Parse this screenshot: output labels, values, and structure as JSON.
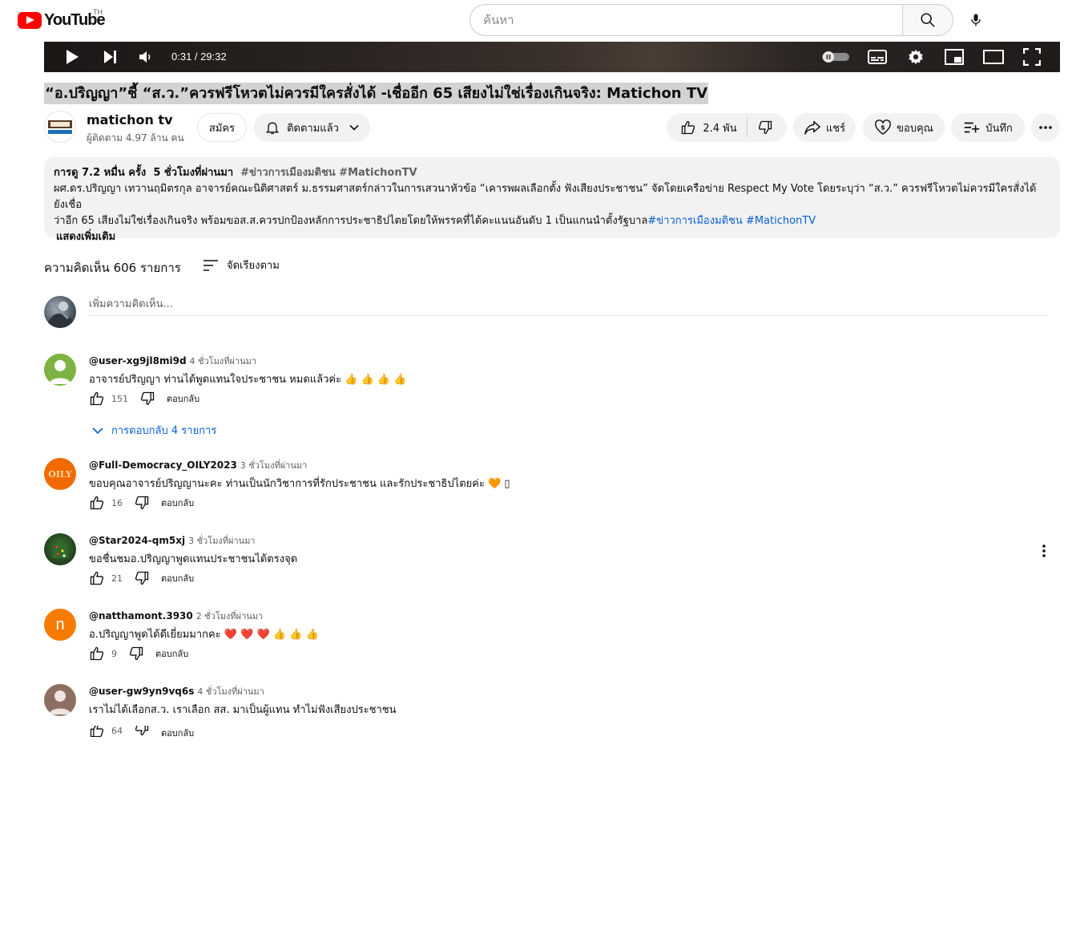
{
  "header": {
    "logo_text": "YouTube",
    "country_code": "TH",
    "search_placeholder": "ค้นหา"
  },
  "player": {
    "time": "0:31 / 29:32"
  },
  "video": {
    "title": "“อ.ปริญญา”ชี้ “ส.ว.”ควรฟรีโหวตไม่ควรมีใครสั่งได้ -เชื่ออีก 65 เสียงไม่ใช่เรื่องเกินจริง: Matichon TV"
  },
  "channel": {
    "name": "matichon tv",
    "subscribers": "ผู้ติดตาม 4.97 ล้าน คน",
    "join_label": "สมัคร",
    "subscribed_label": "ติดตามแล้ว"
  },
  "actions": {
    "likes": "2.4 พัน",
    "share": "แชร์",
    "thanks": "ขอบคุณ",
    "save": "บันทึก"
  },
  "description": {
    "views": "การดู 7.2 หมื่น ครั้ง",
    "posted": "5 ชั่วโมงที่ผ่านมา",
    "tags_top": "#ข่าวการเมืองมติชน #MatichonTV",
    "line1": "ผศ.ดร.ปริญญา เทวานฤมิตรกุล อาจารย์คณะนิติศาสตร์ ม.ธรรมศาสตร์กล่าวในการเสวนาหัวข้อ “เคารพผลเลือกตั้ง ฟังเสียงประชาชน” จัดโดยเครือข่าย Respect My Vote โดยระบุว่า “ส.ว.” ควรฟรีโหวตไม่ควรมีใครสั่งได้ ยังเชื่อ",
    "line2": "ว่าอีก 65 เสียงไม่ใช่เรื่องเกินจริง พร้อมขอส.ส.ควรปกป้องหลักการประชาธิปไตยโดยให้พรรคที่ได้คะแนนอันดับ 1 เป็นแกนนำตั้งรัฐบาล",
    "link1": "#ข่าวการเมืองมติชน",
    "link2": "#MatichonTV",
    "show_more": "แสดงเพิ่มเติม"
  },
  "comments_section": {
    "count_label": "ความคิดเห็น 606 รายการ",
    "sort_label": "จัดเรียงตาม",
    "add_placeholder": "เพิ่มความคิดเห็น..."
  },
  "comments": [
    {
      "author": "@user-xg9jl8mi9d",
      "ago": "4 ชั่วโมงที่ผ่านมา",
      "text": "อาจารย์ปริญญา ท่านได้พูดแทนใจประชาชน หมดแล้วค่ะ 👍 👍 👍 👍",
      "likes": "151",
      "reply": "ตอบกลับ",
      "replies": "การตอบกลับ 4 รายการ"
    },
    {
      "author": "@Full-Democracy_OILY2023",
      "ago": "3 ชั่วโมงที่ผ่านมา",
      "text": "ขอบคุณอาจารย์ปริญญานะคะ ท่านเป็นนักวิชาการที่รักประชาชน และรักประชาธิปไตยค่ะ 🧡 ▯",
      "likes": "16",
      "reply": "ตอบกลับ",
      "avatar_text": "OILY"
    },
    {
      "author": "@Star2024-qm5xj",
      "ago": "3 ชั่วโมงที่ผ่านมา",
      "text": "ขอชื่นชมอ.ปริญญาพูดแทนประชาชนได้ตรงจุด",
      "likes": "21",
      "reply": "ตอบกลับ"
    },
    {
      "author": "@natthamont.3930",
      "ago": "2 ชั่วโมงที่ผ่านมา",
      "text": "อ.ปริญญาพูดได้ดีเยี่ยมมากคะ ❤️ ❤️ ❤️ 👍 👍 👍",
      "likes": "9",
      "reply": "ตอบกลับ",
      "avatar_text": "n"
    },
    {
      "author": "@user-gw9yn9vq6s",
      "ago": "4 ชั่วโมงที่ผ่านมา",
      "text": "เราไม่ได้เลือกส.ว. เราเลือก สส. มาเป็นผู้แทน ทำไม่ฟังเสียงประชาชน",
      "likes": "64",
      "reply": "ตอบกลับ"
    }
  ],
  "colors": {
    "brand_red": "#ff0000",
    "link_blue": "#065fd4",
    "title_highlight": "#d3d3d3",
    "pill_grey": "#f2f2f2"
  }
}
